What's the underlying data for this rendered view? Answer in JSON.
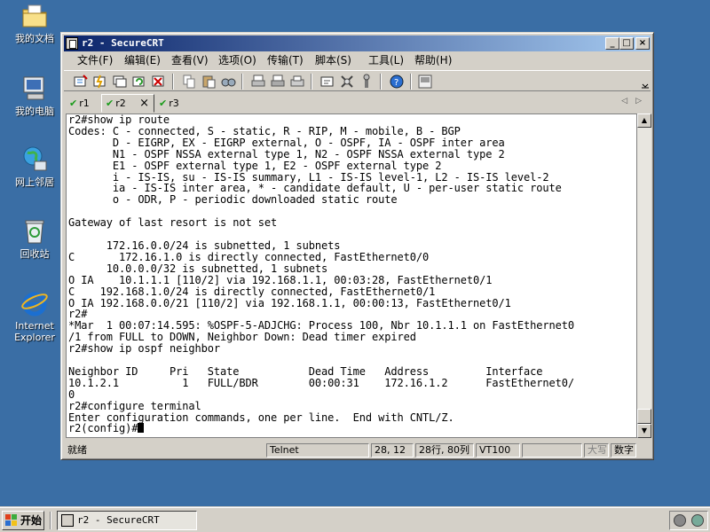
{
  "desktop": {
    "icons": [
      {
        "label": "我的文档"
      },
      {
        "label": "我的电脑"
      },
      {
        "label": "网上邻居"
      },
      {
        "label": "回收站"
      },
      {
        "label": "Internet Explorer"
      }
    ]
  },
  "window": {
    "title": "r2 - SecureCRT",
    "controls": {
      "minimize": "_",
      "maximize": "□",
      "close": "×"
    },
    "menu": [
      "文件(F)",
      "编辑(E)",
      "查看(V)",
      "选项(O)",
      "传输(T)",
      "脚本(S)",
      "工具(L)",
      "帮助(H)"
    ],
    "tabs": [
      {
        "label": "r1",
        "active": false
      },
      {
        "label": "r2",
        "active": true
      },
      {
        "label": "r3",
        "active": false
      }
    ],
    "terminal_text": "r2#show ip route\nCodes: C - connected, S - static, R - RIP, M - mobile, B - BGP\n       D - EIGRP, EX - EIGRP external, O - OSPF, IA - OSPF inter area\n       N1 - OSPF NSSA external type 1, N2 - OSPF NSSA external type 2\n       E1 - OSPF external type 1, E2 - OSPF external type 2\n       i - IS-IS, su - IS-IS summary, L1 - IS-IS level-1, L2 - IS-IS level-2\n       ia - IS-IS inter area, * - candidate default, U - per-user static route\n       o - ODR, P - periodic downloaded static route\n\nGateway of last resort is not set\n\n      172.16.0.0/24 is subnetted, 1 subnets\nC       172.16.1.0 is directly connected, FastEthernet0/0\n      10.0.0.0/32 is subnetted, 1 subnets\nO IA    10.1.1.1 [110/2] via 192.168.1.1, 00:03:28, FastEthernet0/1\nC    192.168.1.0/24 is directly connected, FastEthernet0/1\nO IA 192.168.0.0/21 [110/2] via 192.168.1.1, 00:00:13, FastEthernet0/1\nr2#\n*Mar  1 00:07:14.595: %OSPF-5-ADJCHG: Process 100, Nbr 10.1.1.1 on FastEthernet0\n/1 from FULL to DOWN, Neighbor Down: Dead timer expired\nr2#show ip ospf neighbor\n\nNeighbor ID     Pri   State           Dead Time   Address         Interface\n10.1.2.1          1   FULL/BDR        00:00:31    172.16.1.2      FastEthernet0/\n0\nr2#configure terminal\nEnter configuration commands, one per line.  End with CNTL/Z.",
    "prompt": "r2(config)#",
    "status": {
      "ready": "就绪",
      "protocol": "Telnet",
      "cursor_pos": "28, 12",
      "size": "28行, 80列",
      "emulation": "VT100",
      "caps": "大写",
      "num": "数字"
    }
  },
  "taskbar": {
    "start_label": "开始",
    "task_label": "r2 - SecureCRT"
  }
}
